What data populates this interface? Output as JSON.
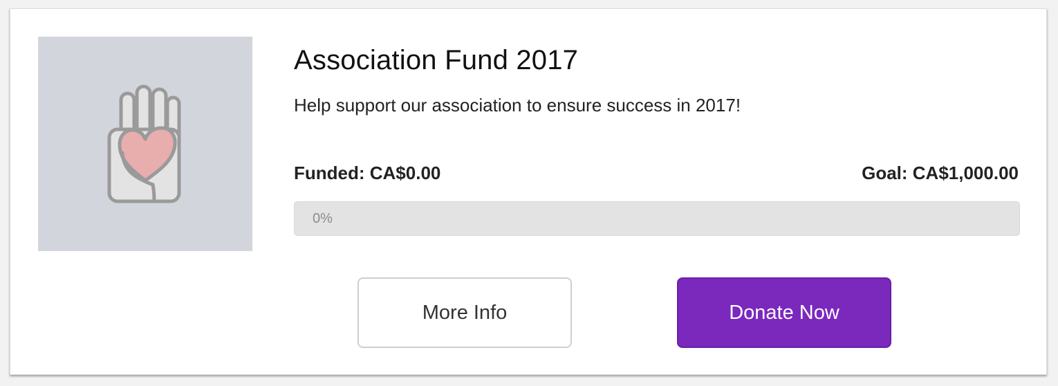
{
  "campaign": {
    "image_icon": "hand-heart-icon",
    "title": "Association Fund 2017",
    "description": "Help support our association to ensure success in 2017!",
    "funded_text": "Funded: CA$0.00",
    "goal_text": "Goal: CA$1,000.00",
    "progress_percent": 0,
    "progress_label": "0%"
  },
  "actions": {
    "more_info_label": "More Info",
    "donate_label": "Donate Now"
  },
  "colors": {
    "accent": "#7b28bd",
    "thumbnail_bg": "#d3d5dc",
    "heart": "#e8adad",
    "progress_track": "#e3e3e3"
  }
}
